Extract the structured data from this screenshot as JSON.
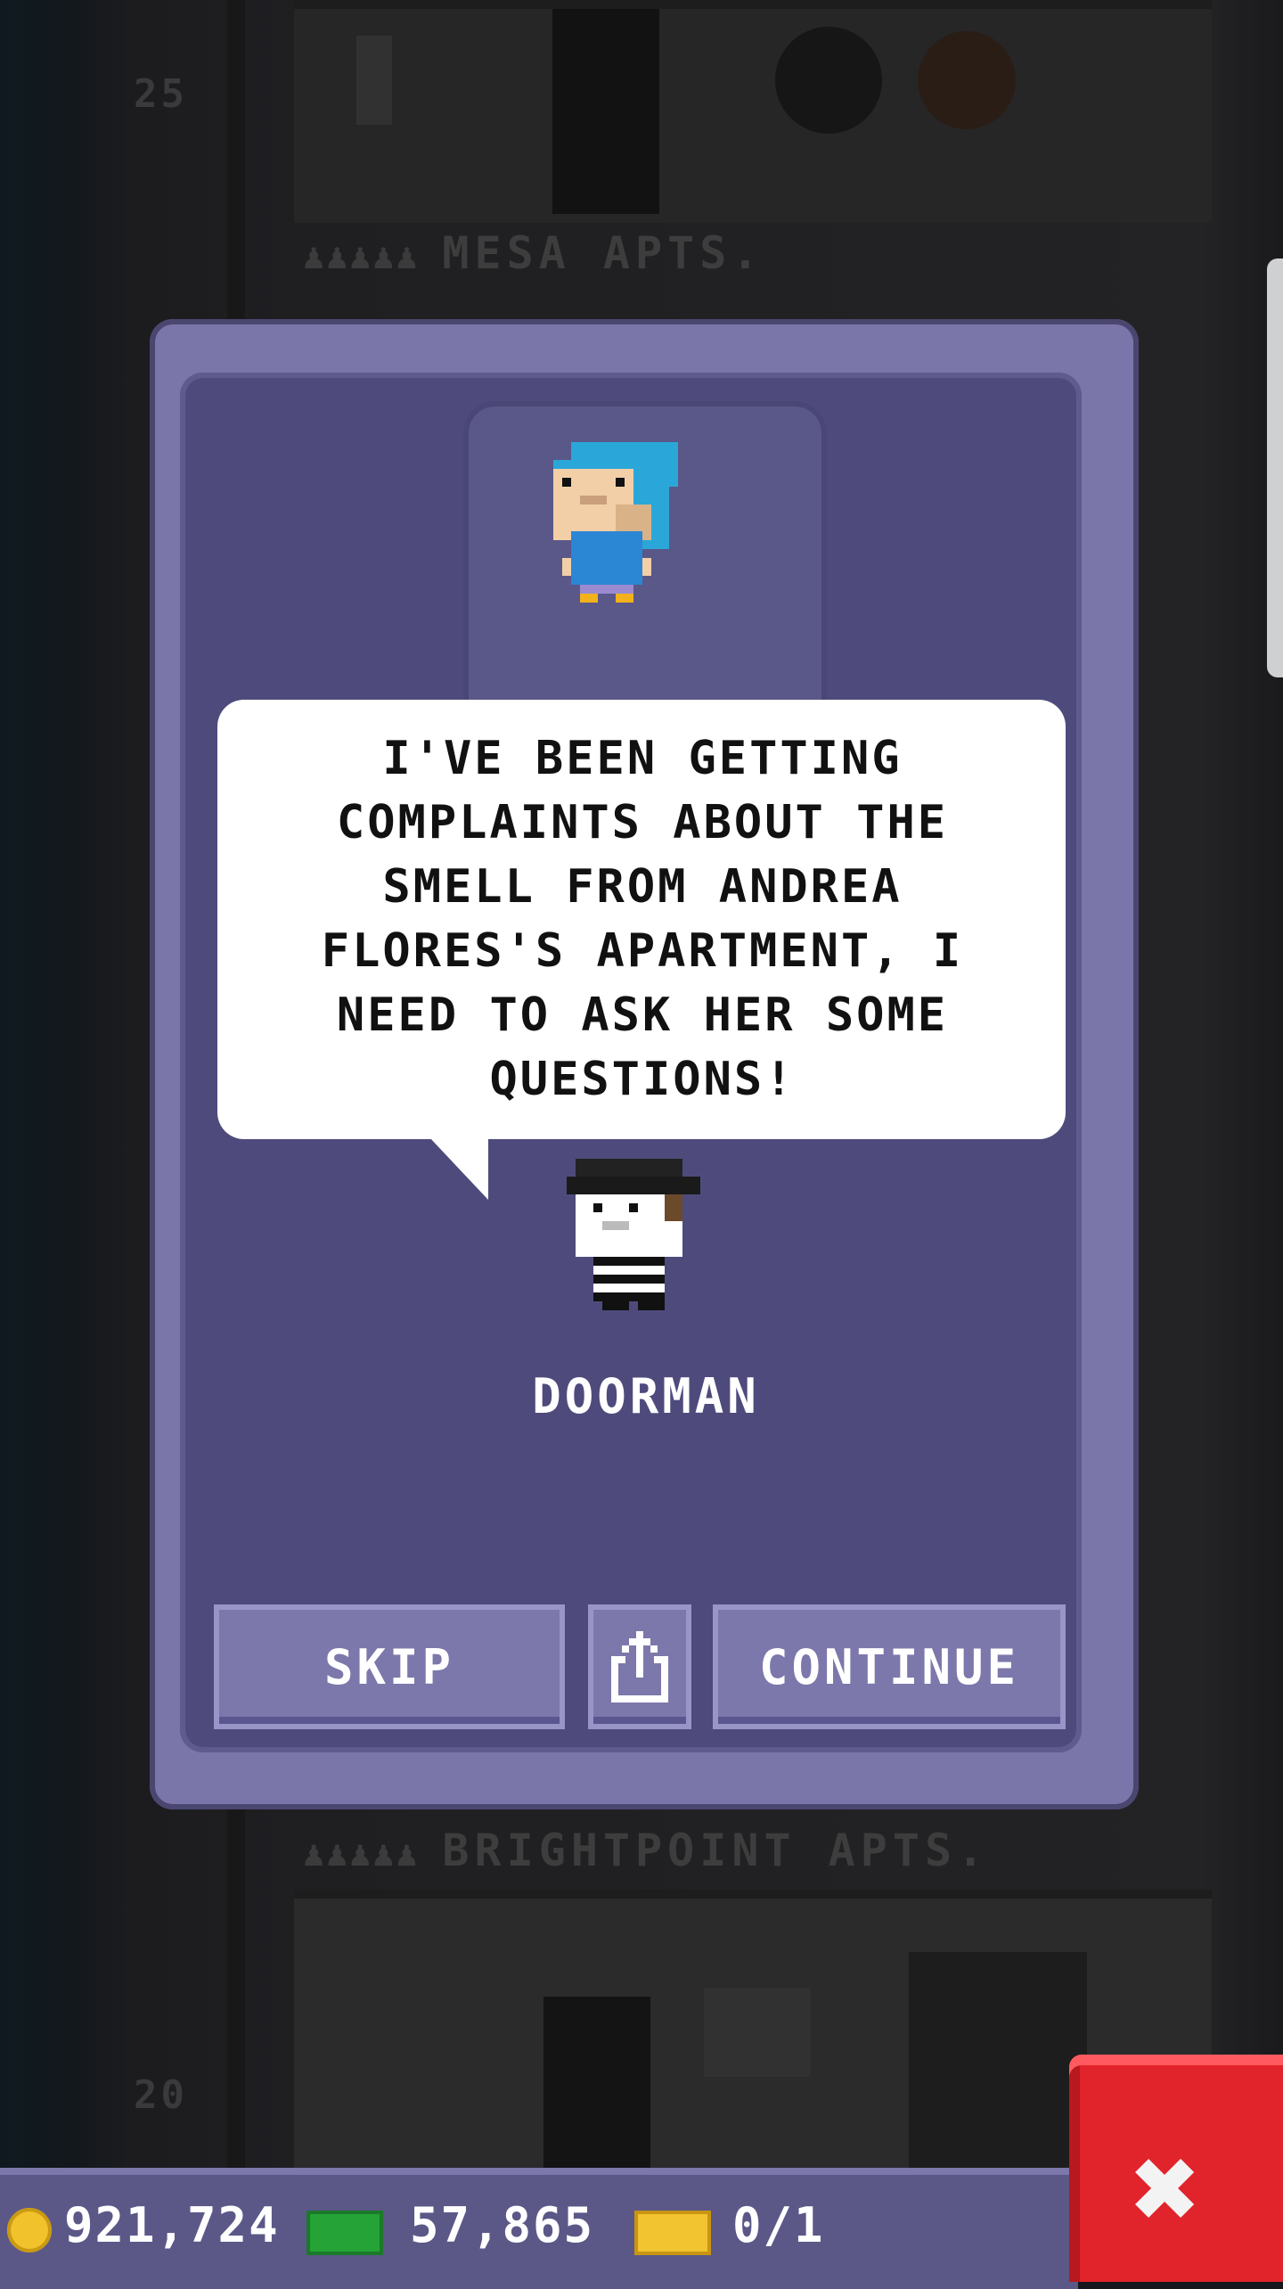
{
  "background": {
    "floors": [
      {
        "number": "25",
        "tower": "MESA APTS."
      },
      {
        "number": "20",
        "tower": "BRIGHTPOINT APTS."
      }
    ],
    "people_icons": "♟♟♟♟♟"
  },
  "dialog": {
    "message": "I'VE BEEN GETTING COMPLAINTS ABOUT THE SMELL FROM ANDREA FLORES'S APARTMENT, I NEED TO ASK HER SOME QUESTIONS!",
    "speaker": "DOORMAN",
    "buttons": {
      "skip": "SKIP",
      "continue": "CONTINUE",
      "share_icon": "share-icon"
    }
  },
  "resources": {
    "coins": "921,724",
    "bux": "57,865",
    "tickets": "0/1"
  },
  "close_icon": "close-icon",
  "colors": {
    "dialog_outer": "#7b76aa",
    "dialog_inner": "#4e4b7c",
    "button": "#7c78ab",
    "close": "#e1232b",
    "coin": "#f1c22c",
    "bux": "#25a336"
  }
}
